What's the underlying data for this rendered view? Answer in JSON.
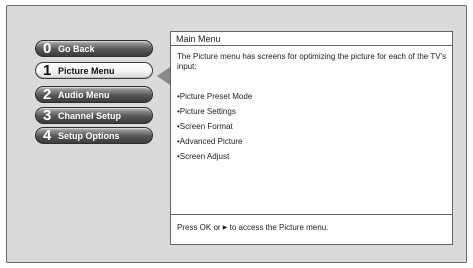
{
  "menu": {
    "items": [
      {
        "number": "0",
        "label": "Go Back",
        "selected": false
      },
      {
        "number": "1",
        "label": "Picture Menu",
        "selected": true
      },
      {
        "number": "2",
        "label": "Audio Menu",
        "selected": false
      },
      {
        "number": "3",
        "label": "Channel Setup",
        "selected": false
      },
      {
        "number": "4",
        "label": "Setup Options",
        "selected": false
      }
    ]
  },
  "panel": {
    "title": "Main Menu",
    "description": "The Picture menu has screens for optimizing the picture for each of the TV’s input:",
    "list": [
      "•Picture Preset Mode",
      "•Picture Settings",
      "•Screen Format",
      "•Advanced Picture",
      "•Screen Adjust"
    ],
    "footer": {
      "before": "Press OK or ",
      "icon": "right-arrow-icon",
      "after": " to access the Picture menu."
    }
  }
}
